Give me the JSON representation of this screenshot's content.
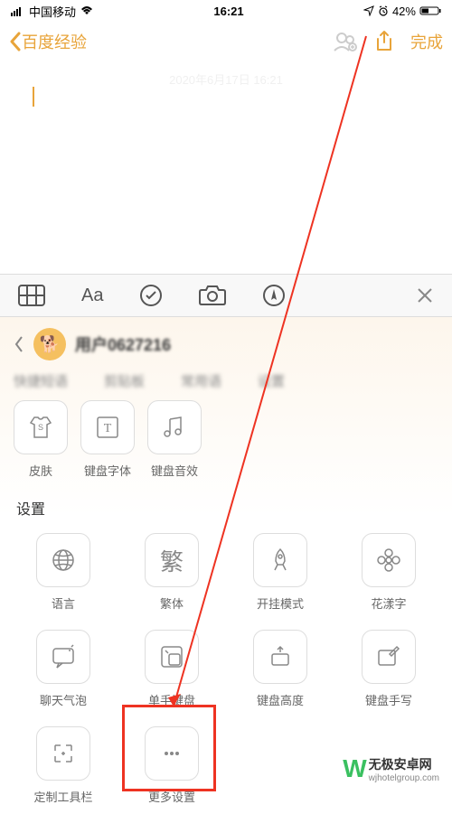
{
  "status": {
    "carrier": "中国移动",
    "time": "16:21",
    "battery": "42%"
  },
  "nav": {
    "back": "百度经验",
    "done": "完成"
  },
  "note": {
    "date": "2020年6月17日 16:21"
  },
  "panel": {
    "user": "用户0627216"
  },
  "tabs": {
    "t1": "快捷短语",
    "t2": "剪贴板",
    "t3": "常用语",
    "t4": "设置"
  },
  "row1": {
    "skin": "皮肤",
    "font": "键盘字体",
    "sound": "键盘音效"
  },
  "section": {
    "settings": "设置"
  },
  "grid": {
    "lang": "语言",
    "trad": "繁体",
    "mode": "开挂模式",
    "flower": "花漾字",
    "bubble": "聊天气泡",
    "onehand": "单手键盘",
    "height": "键盘高度",
    "handwrite": "键盘手写",
    "custom": "定制工具栏",
    "more": "更多设置"
  },
  "trad_char": "繁",
  "watermark": {
    "title": "无极安卓网",
    "url": "wjhotelgroup.com"
  }
}
